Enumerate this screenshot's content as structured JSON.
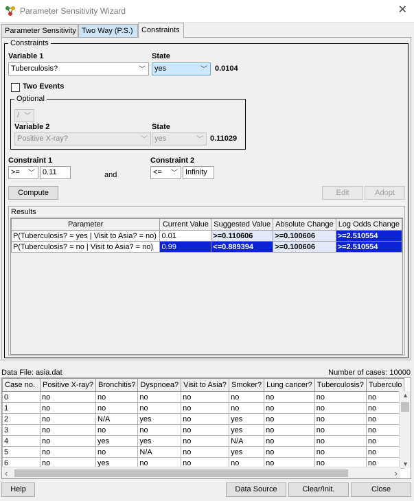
{
  "window": {
    "title": "Parameter Sensitivity Wizard"
  },
  "tabs": [
    {
      "label": "Parameter Sensitivity"
    },
    {
      "label": "Two Way (P.S.)"
    },
    {
      "label": "Constraints"
    }
  ],
  "constraints": {
    "group_label": "Constraints",
    "variable1_label": "Variable 1",
    "variable1_value": "Tuberculosis?",
    "state_label": "State",
    "state1_value": "yes",
    "state1_prob": "0.0104",
    "two_events_label": "Two Events",
    "optional_label": "Optional",
    "optional_op": "/",
    "variable2_label": "Variable 2",
    "variable2_value": "Positive X-ray?",
    "state2_label": "State",
    "state2_value": "yes",
    "state2_prob": "0.11029",
    "constraint1_label": "Constraint 1",
    "constraint1_op": ">=",
    "constraint1_value": "0.11",
    "and_label": "and",
    "constraint2_label": "Constraint 2",
    "constraint2_op": "<=",
    "constraint2_value": "Infinity",
    "compute_label": "Compute",
    "edit_label": "Edit",
    "adopt_label": "Adopt"
  },
  "results": {
    "title": "Results",
    "headers": [
      "Parameter",
      "Current Value",
      "Suggested Value",
      "Absolute Change",
      "Log Odds Change"
    ],
    "rows": [
      [
        "P(Tuberculosis? = yes | Visit to Asia? = no)",
        "0.01",
        ">=0.110606",
        ">=0.100606",
        ">=2.510554"
      ],
      [
        "P(Tuberculosis? = no | Visit to Asia? = no)",
        "0.99",
        "<=0.889394",
        ">=0.100606",
        ">=2.510554"
      ]
    ]
  },
  "data": {
    "file_label": "Data File: asia.dat",
    "cases_label": "Number of cases: 10000",
    "headers": [
      "Case no.",
      "Positive X-ray?",
      "Bronchitis?",
      "Dyspnoea?",
      "Visit to Asia?",
      "Smoker?",
      "Lung cancer?",
      "Tuberculosis?",
      "Tuberculo"
    ],
    "rows": [
      [
        "0",
        "no",
        "no",
        "no",
        "no",
        "no",
        "no",
        "no",
        "no"
      ],
      [
        "1",
        "no",
        "no",
        "no",
        "no",
        "no",
        "no",
        "no",
        "no"
      ],
      [
        "2",
        "no",
        "N/A",
        "yes",
        "no",
        "yes",
        "no",
        "no",
        "no"
      ],
      [
        "3",
        "no",
        "no",
        "no",
        "no",
        "yes",
        "no",
        "no",
        "no"
      ],
      [
        "4",
        "no",
        "yes",
        "yes",
        "no",
        "N/A",
        "no",
        "no",
        "no"
      ],
      [
        "5",
        "no",
        "no",
        "N/A",
        "no",
        "yes",
        "no",
        "no",
        "no"
      ],
      [
        "6",
        "no",
        "yes",
        "no",
        "no",
        "no",
        "no",
        "no",
        "no"
      ]
    ]
  },
  "footer": {
    "help_label": "Help",
    "data_source_label": "Data Source",
    "clear_label": "Clear/Init.",
    "close_label": "Close"
  },
  "colors": {
    "selection_blue": "#0a24d6",
    "pale_highlight": "#e3e8fb",
    "combo_selected": "#cce8ff"
  }
}
